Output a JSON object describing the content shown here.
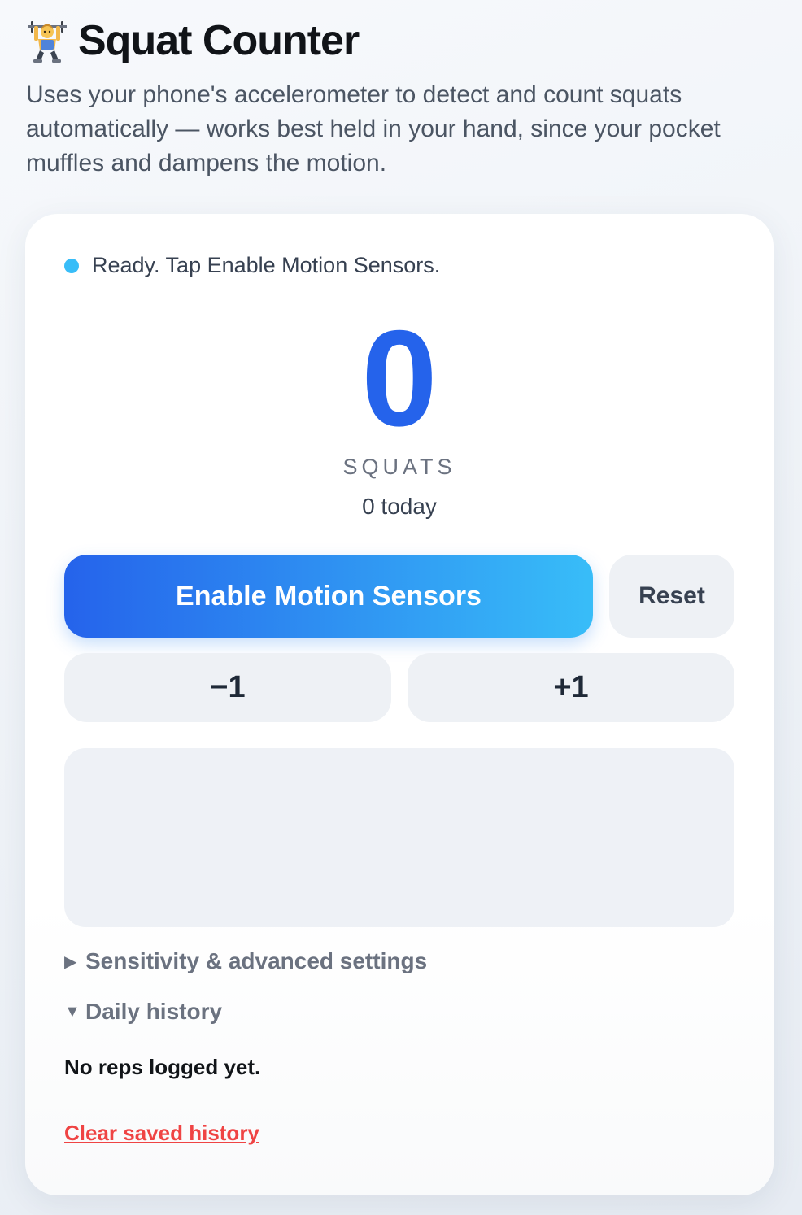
{
  "header": {
    "title_icon": "weightlifter-icon",
    "title": "Squat Counter",
    "intro": "Uses your phone's accelerometer to detect and count squats automatically — works best held in your hand, since your pocket muffles and dampens the motion."
  },
  "status": {
    "dot_color": "#38bdf8",
    "text": "Ready. Tap Enable Motion Sensors."
  },
  "counter": {
    "value": "0",
    "label": "SQUATS",
    "today": "0 today"
  },
  "buttons": {
    "enable": "Enable Motion Sensors",
    "reset": "Reset",
    "minus": "−1",
    "plus": "+1"
  },
  "settings": {
    "summary": "Sensitivity & advanced settings",
    "expanded": false
  },
  "history": {
    "summary": "Daily history",
    "expanded": true,
    "empty_text": "No reps logged yet.",
    "clear_label": "Clear saved history"
  },
  "colors": {
    "accent": "#2563eb",
    "accent_light": "#38bdf8",
    "danger": "#ef4444"
  }
}
